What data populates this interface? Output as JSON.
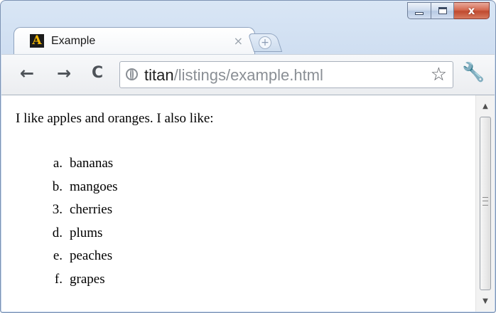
{
  "window": {
    "tab": {
      "title": "Example",
      "favicon_letter": "A",
      "close_glyph": "×"
    },
    "new_tab_glyph": "+",
    "caption": {
      "minimize": "minimize",
      "maximize": "maximize",
      "close_glyph": "x"
    }
  },
  "toolbar": {
    "back_glyph": "←",
    "forward_glyph": "→",
    "reload_glyph": "C",
    "url_host": "titan",
    "url_path": "/listings/example.html",
    "star_glyph": "☆",
    "wrench_glyph": "🔧"
  },
  "page": {
    "intro": "I like apples and oranges. I also like:",
    "items": [
      {
        "marker": "a.",
        "text": "bananas"
      },
      {
        "marker": "b.",
        "text": "mangoes"
      },
      {
        "marker": "3.",
        "text": "cherries"
      },
      {
        "marker": "d.",
        "text": "plums"
      },
      {
        "marker": "e.",
        "text": "peaches"
      },
      {
        "marker": "f.",
        "text": "grapes"
      }
    ]
  },
  "scrollbar": {
    "up_glyph": "▲",
    "down_glyph": "▼"
  }
}
